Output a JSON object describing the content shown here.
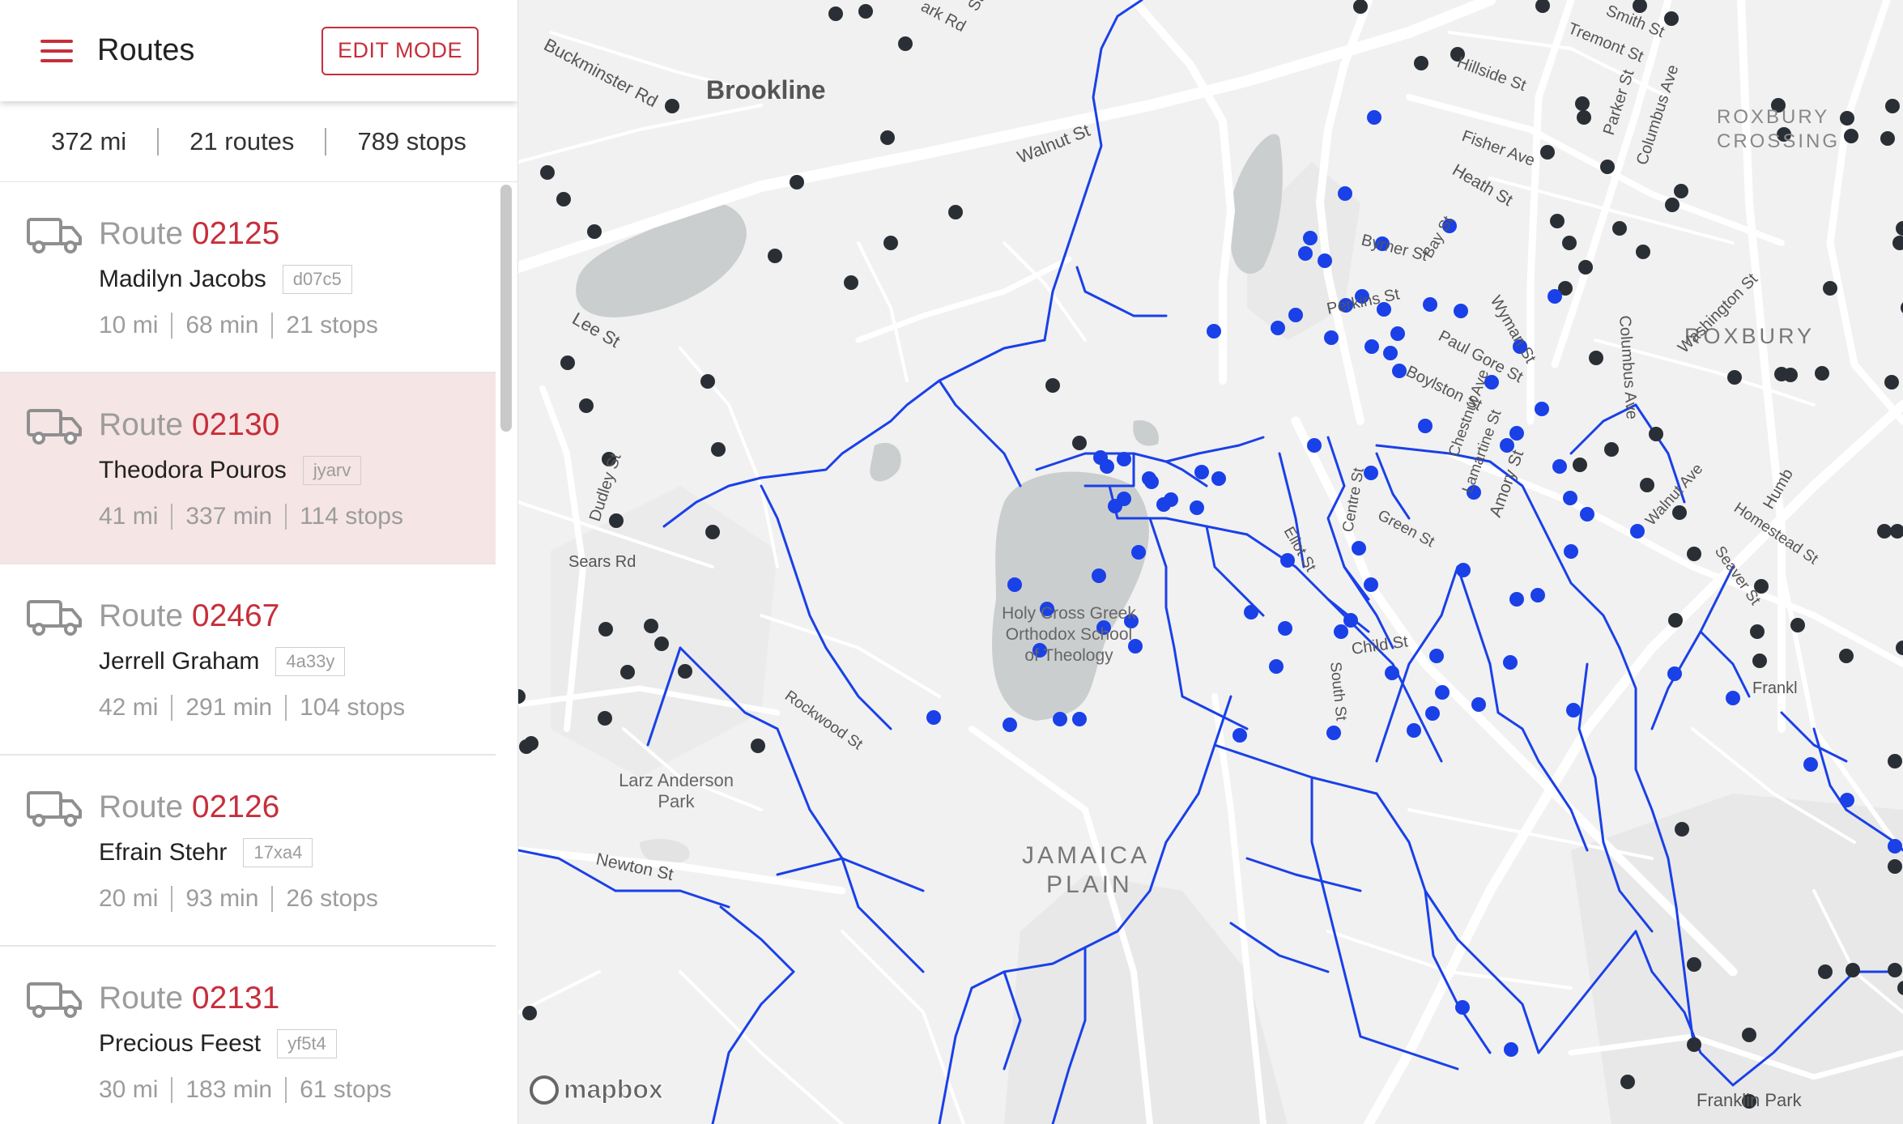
{
  "header": {
    "title": "Routes",
    "edit_label": "EDIT MODE"
  },
  "summary": {
    "distance": "372 mi",
    "routes": "21 routes",
    "stops": "789 stops"
  },
  "routes": [
    {
      "prefix": "Route",
      "id": "02125",
      "driver": "Madilyn Jacobs",
      "code": "d07c5",
      "distance": "10 mi",
      "duration": "68 min",
      "stops": "21 stops",
      "selected": false
    },
    {
      "prefix": "Route",
      "id": "02130",
      "driver": "Theodora Pouros",
      "code": "jyarv",
      "distance": "41 mi",
      "duration": "337 min",
      "stops": "114 stops",
      "selected": true
    },
    {
      "prefix": "Route",
      "id": "02467",
      "driver": "Jerrell Graham",
      "code": "4a33y",
      "distance": "42 mi",
      "duration": "291 min",
      "stops": "104 stops",
      "selected": false
    },
    {
      "prefix": "Route",
      "id": "02126",
      "driver": "Efrain Stehr",
      "code": "17xa4",
      "distance": "20 mi",
      "duration": "93 min",
      "stops": "26 stops",
      "selected": false
    },
    {
      "prefix": "Route",
      "id": "02131",
      "driver": "Precious Feest",
      "code": "yf5t4",
      "distance": "30 mi",
      "duration": "183 min",
      "stops": "61 stops",
      "selected": false
    }
  ],
  "map": {
    "labels": {
      "brookline": "Brookline",
      "jamaica": "JAMAICA",
      "plain": "PLAIN",
      "roxbury": "ROXBURY",
      "roxbury_crossing_1": "ROXBURY",
      "roxbury_crossing_2": "CROSSING",
      "holy_cross_1": "Holy Cross Greek",
      "holy_cross_2": "Orthodox School",
      "holy_cross_3": "of Theology",
      "larz_1": "Larz Anderson",
      "larz_2": "Park",
      "franklin_park": "Franklin Park",
      "buckminster": "Buckminster Rd",
      "walnut": "Walnut St",
      "lee": "Lee St",
      "dudley": "Dudley St",
      "sears": "Sears Rd",
      "rockwood": "Rockwood St",
      "newton": "Newton St",
      "byrner": "Byrner St",
      "perkins": "Perkins St",
      "boylston": "Boylston St",
      "paul_gore": "Paul Gore St",
      "wyman": "Wyman St",
      "chestnut": "Chestnut Ave",
      "lamartine": "Lamartine St",
      "amory": "Amory St",
      "centre": "Centre St",
      "green": "Green St",
      "eliot": "Eliot St",
      "child": "Child St",
      "south": "South St",
      "hillside": "Hillside St",
      "fisher": "Fisher Ave",
      "heath": "Heath St",
      "parker": "Parker St",
      "columbus1": "Columbus Ave",
      "columbus2": "Columbus Ave",
      "washington": "Washington St",
      "walnut_ave": "Walnut Ave",
      "homestead": "Homestead St",
      "seaver": "Seaver St",
      "smith": "Smith St",
      "tremont": "Tremont St",
      "bay": "Bay St",
      "franklin": "Frankl",
      "humb": "Humb",
      "park_st": "ark Rd",
      "st_top": "St"
    },
    "attribution": "mapbox",
    "route_color": "#1a40e8",
    "stop_color": "#2a2f36"
  }
}
